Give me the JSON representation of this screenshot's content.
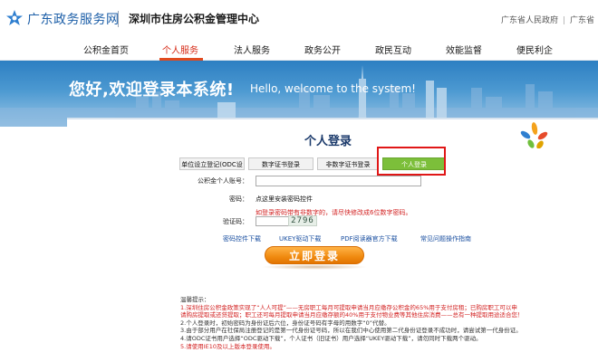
{
  "header": {
    "brand": "广东政务服务网",
    "center_name": "深圳市住房公积金管理中心",
    "top_links": [
      "广东省人民政府",
      "广东省"
    ]
  },
  "nav": {
    "items": [
      "公积金首页",
      "个人服务",
      "法人服务",
      "政务公开",
      "政民互动",
      "效能监督",
      "便民利企"
    ],
    "active": "个人服务"
  },
  "banner": {
    "greeting_cn": "您好,欢迎登录本系统!",
    "greeting_en": "Hello, welcome to the system!"
  },
  "login": {
    "title": "个人登录",
    "tabs": [
      "单位设立登记(ODC设",
      "数字证书登录",
      "非数字证书登录",
      "个人登录"
    ],
    "active_tab": "个人登录",
    "account_label": "公积金个人账号：",
    "account_value": "",
    "password_label": "密码：",
    "password_hint": "点这里安装密码控件",
    "warning": "如登录密码带有非数字的，请尽快修改成6位数字密码。",
    "captcha_label": "验证码：",
    "captcha_value": "2796",
    "links": [
      "密码控件下载",
      "UKEY驱动下载",
      "PDF阅读器官方下载",
      "常见问题操作指南"
    ],
    "submit": "立即登录"
  },
  "notes": {
    "title": "温馨提示：",
    "items": [
      {
        "text": "1.深圳住房公积金政策实现了“人人可提”——无房职工每月可提取申请当月应缴存公积金的65%用于支付房租；已购房职工可以申",
        "red": true
      },
      {
        "text": "请购房提取或还贷提取；职工还可每月提取申请当月应缴存额的40%用于支付物业费等其他住房消费——总有一种提取用途适合您！",
        "red": true
      },
      {
        "text": "2.个人登录时，初始密码为身份证后六位，身份证号码有字母的用数字“0”代替。",
        "red": false
      },
      {
        "text": "3.由于部分用户在社保局注册登记的是第一代身份证号码，所以在我们中心使用第二代身份证登录不成功时，请尝试第一代身份证。",
        "red": false
      },
      {
        "text": "4.请ODC证书用户选择“ODC驱动下载”，个人证书（旧证书）用户选择“UKEY驱动下载”，请勿同时下载两个驱动。",
        "red": false
      },
      {
        "text": "5.请使用IE10及以上版本登录使用。",
        "red": true
      }
    ]
  },
  "colors": {
    "brand_blue": "#1d5fa8",
    "nav_active": "#d62a16",
    "tab_active": "#7cbf3a",
    "login_button": "#f08a10",
    "warning_red": "#d21f1f"
  }
}
